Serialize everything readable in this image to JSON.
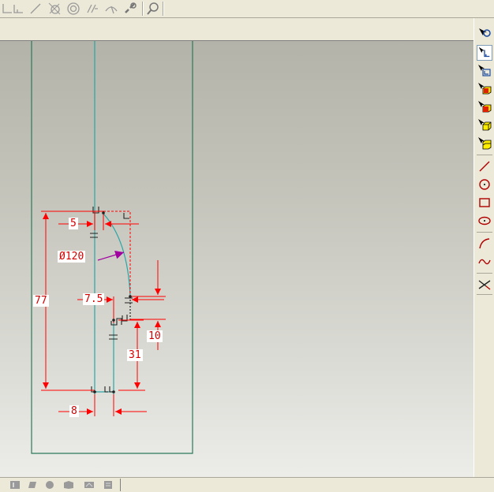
{
  "colors": {
    "dimension": "#ff0000",
    "boundary": "#2a7a5a",
    "centerline": "#2aa5a5",
    "arc": "#2aa5a5",
    "radius_leader": "#a000a0"
  },
  "top_toolbar": {
    "icons": [
      "corner-line-icon",
      "diagonal-line-icon",
      "circle-cross-icon",
      "concentric-circle-icon",
      "parallel-lines-icon",
      "tangent-arc-icon",
      "chain-link-icon",
      "zoom-icon"
    ]
  },
  "right_toolbar": {
    "icons": [
      "select-rotate-icon",
      "select-sketch-icon",
      "select-corner-icon",
      "select-red-box-icon",
      "select-red-cube-icon",
      "select-yellow-cube-icon",
      "select-yellow-stack-icon",
      "line-icon",
      "circle-icon",
      "rectangle-icon",
      "ellipse-icon",
      "arc-icon",
      "spline-icon",
      "trim-icon"
    ]
  },
  "status_bar": {
    "icons": [
      "status-icon-1",
      "status-icon-2",
      "status-icon-3",
      "status-icon-4",
      "status-icon-5",
      "status-icon-6"
    ]
  },
  "dimensions": {
    "d_5": "5",
    "d_phi120": "Ø120",
    "d_7_5": "7.5",
    "d_77": "77",
    "d_10": "10",
    "d_31": "31",
    "d_8": "8"
  }
}
